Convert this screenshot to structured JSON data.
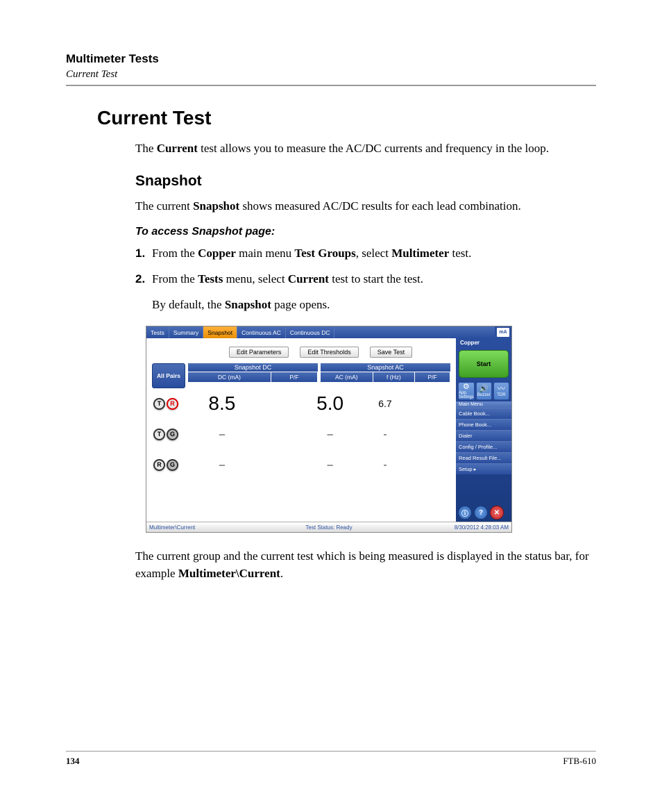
{
  "header": {
    "chapter": "Multimeter Tests",
    "section": "Current Test"
  },
  "h1": "Current Test",
  "intro": {
    "pre": "The ",
    "b1": "Current",
    "post": " test allows you to measure the AC/DC currents and frequency in the loop."
  },
  "h2": "Snapshot",
  "snapshot_intro": {
    "pre": "The current ",
    "b1": "Snapshot",
    "post": " shows measured AC/DC results for each lead combination."
  },
  "access_heading": "To access Snapshot page:",
  "steps": [
    {
      "num": "1.",
      "pre": "From the ",
      "b1": "Copper",
      "mid1": " main menu ",
      "b2": "Test Groups",
      "mid2": ", select ",
      "b3": "Multimeter",
      "post": " test."
    },
    {
      "num": "2.",
      "pre": "From the ",
      "b1": "Tests",
      "mid1": " menu, select ",
      "b2": "Current",
      "post": " test to start the test."
    }
  ],
  "default_para": {
    "pre": "By default, the ",
    "b1": "Snapshot",
    "post": " page opens."
  },
  "closing": {
    "pre": "The current group and the current test which is being measured is displayed in the status bar, for example ",
    "b1": "Multimeter\\Current",
    "post": "."
  },
  "footer": {
    "page": "134",
    "model": "FTB-610"
  },
  "screenshot": {
    "tabs": [
      "Tests",
      "Summary",
      "Snapshot",
      "Continuous AC",
      "Continuous DC"
    ],
    "active_tab": "Snapshot",
    "ma_icon": "mA",
    "buttons": [
      "Edit Parameters",
      "Edit Thresholds",
      "Save Test"
    ],
    "allpairs": "All Pairs",
    "dc_title": "Snapshot DC",
    "ac_title": "Snapshot AC",
    "dc_cols": [
      "DC (mA)",
      "P/F"
    ],
    "ac_cols": [
      "AC (mA)",
      "f (Hz)",
      "P/F"
    ],
    "rows": [
      {
        "pair": [
          "T",
          "R"
        ],
        "pair_classes": [
          "pp-T",
          "pp-R"
        ],
        "dc": "8.5",
        "ac": "5.0",
        "f": "6.7"
      },
      {
        "pair": [
          "T",
          "G"
        ],
        "pair_classes": [
          "pp-T",
          "pp-G"
        ],
        "dc": "–",
        "ac": "–",
        "f": "-"
      },
      {
        "pair": [
          "R",
          "G"
        ],
        "pair_classes": [
          "pp-R pp-T",
          "pp-G"
        ],
        "dc": "–",
        "ac": "–",
        "f": "-"
      }
    ],
    "status": {
      "left": "Multimeter\\Current",
      "mid": "Test Status: Ready",
      "right": "8/30/2012 4:28:03 AM"
    },
    "side": {
      "title": "Copper",
      "start": "Start",
      "icons": [
        {
          "ic": "⚙",
          "label": "App. Settings"
        },
        {
          "ic": "🔊",
          "label": "Buzzer"
        },
        {
          "ic": "〰",
          "label": "TDR"
        }
      ],
      "menuhdr": "Main Menu",
      "menu": [
        "Cable Book...",
        "Phone Book...",
        "Dialer",
        "Config / Profile...",
        "Read Result File...",
        "Setup        ▸"
      ],
      "bottom_icons": [
        "ⓘ",
        "?",
        "✕"
      ]
    }
  }
}
